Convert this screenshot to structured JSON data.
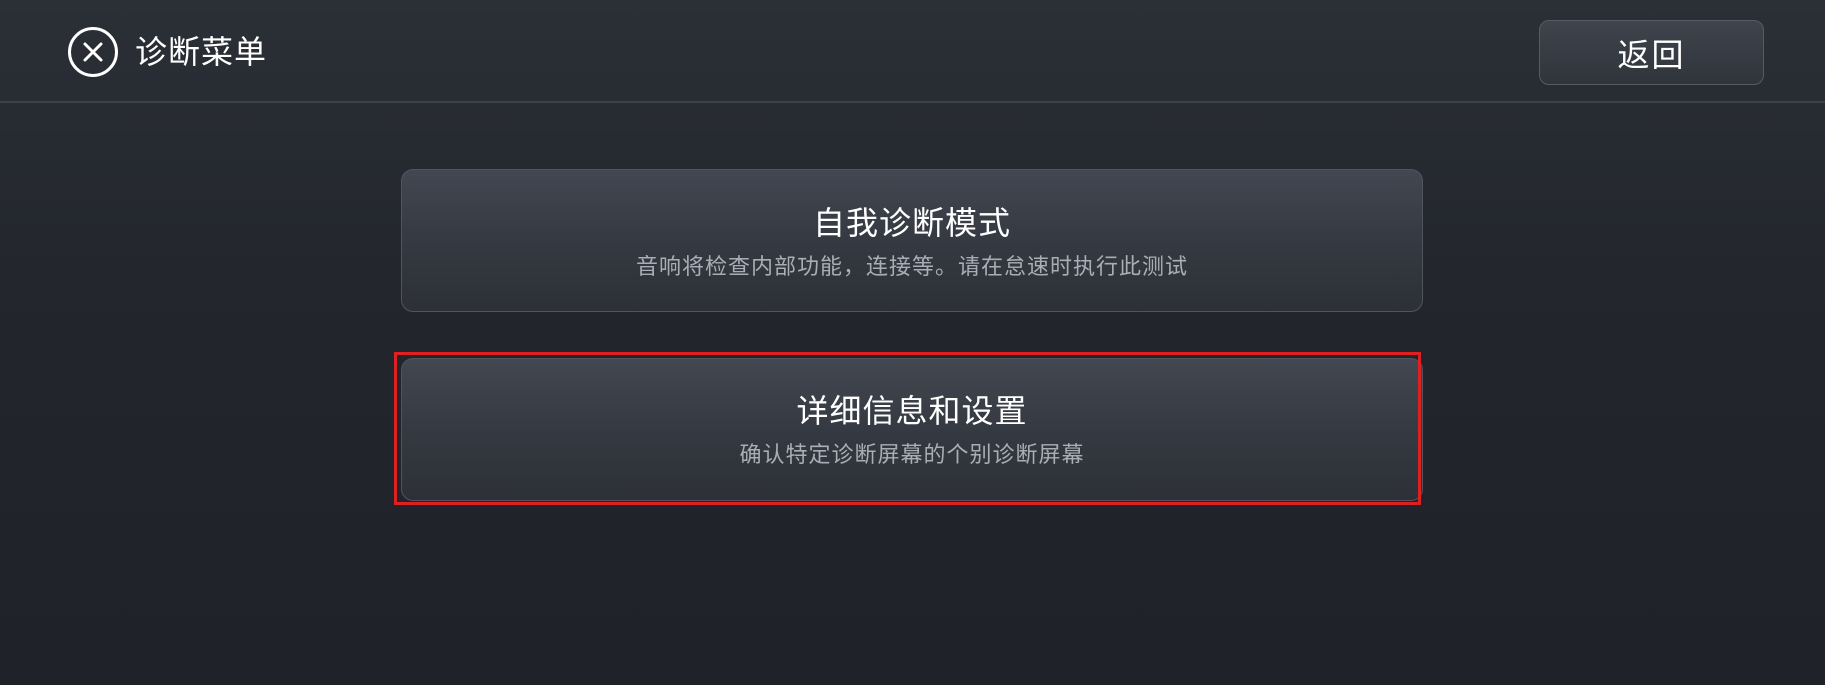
{
  "header": {
    "title": "诊断菜单",
    "close_icon": "close-circle-icon",
    "back_label": "返回"
  },
  "menu": {
    "items": [
      {
        "title": "自我诊断模式",
        "description": "音响将检查内部功能，连接等。请在怠速时执行此测试"
      },
      {
        "title": "详细信息和设置",
        "description": "确认特定诊断屏幕的个别诊断屏幕",
        "highlighted": true
      }
    ]
  },
  "colors": {
    "background": "#23262d",
    "card": "#383c44",
    "text_primary": "#ffffff",
    "text_secondary": "#a9adb5",
    "highlight": "#e02020"
  }
}
